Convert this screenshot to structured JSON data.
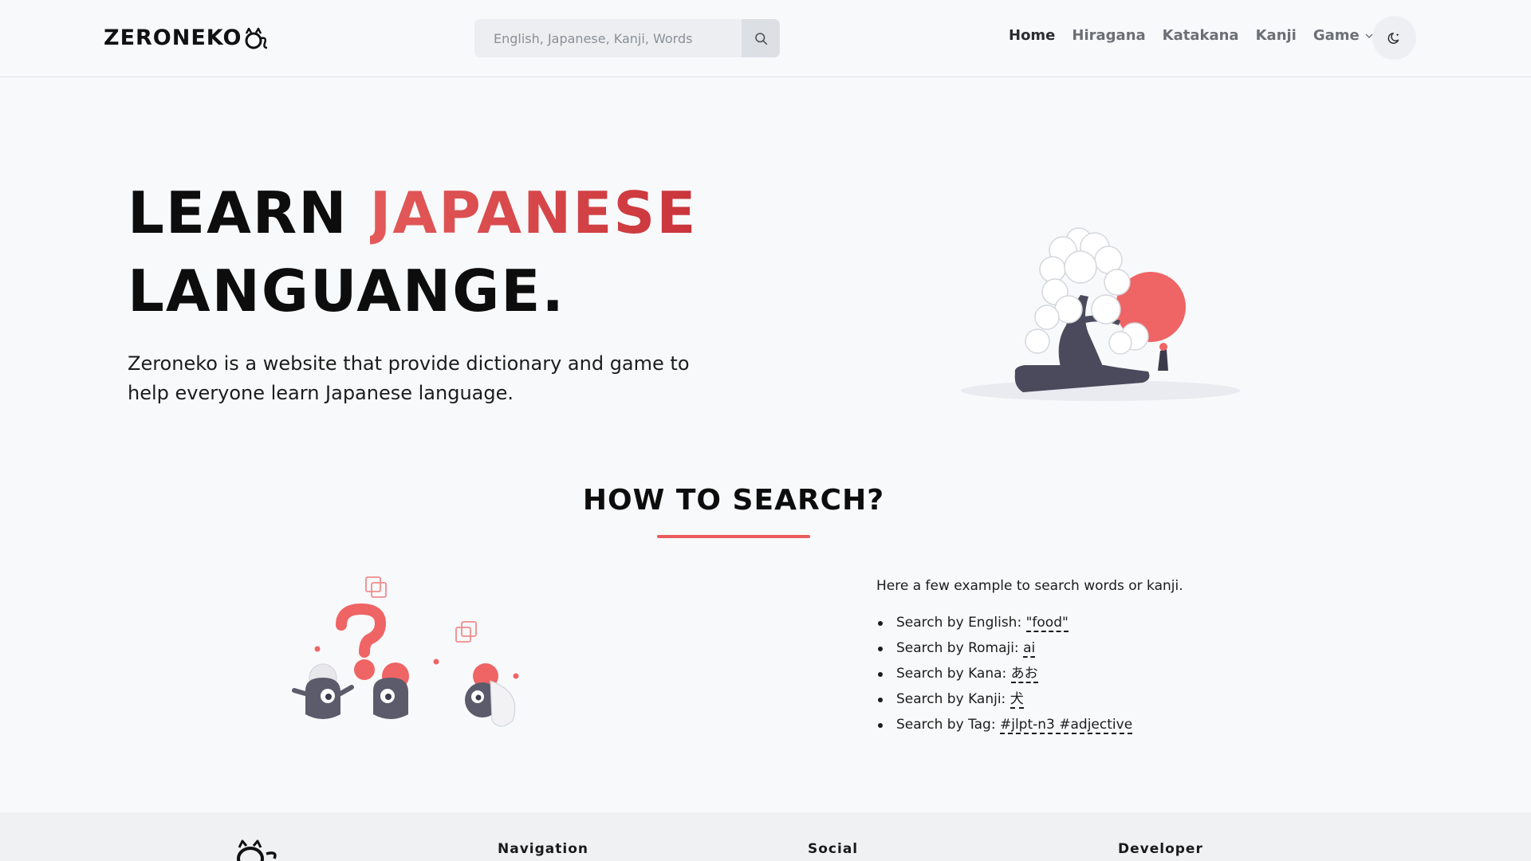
{
  "header": {
    "logo_text": "ZERONEKO",
    "search": {
      "placeholder": "English, Japanese, Kanji, Words"
    },
    "nav": [
      {
        "label": "Home",
        "active": true
      },
      {
        "label": "Hiragana"
      },
      {
        "label": "Katakana"
      },
      {
        "label": "Kanji"
      },
      {
        "label": "Game",
        "has_dropdown": true
      }
    ],
    "theme_icon": "moon-sparkle-icon"
  },
  "hero": {
    "title_part1": "LEARN",
    "title_accent": "JAPANESE",
    "title_line2": "LANGUANGE.",
    "description": "Zeroneko is a website that provide dictionary and game to help everyone learn Japanese language.",
    "accent_color": "#d9434a"
  },
  "how_to_search": {
    "title": "HOW TO SEARCH?",
    "intro": "Here a few example to search words or kanji.",
    "examples": [
      {
        "label": "Search by English:",
        "query": "\"food\""
      },
      {
        "label": "Search by Romaji:",
        "query": "ai"
      },
      {
        "label": "Search by Kana:",
        "query": "あお"
      },
      {
        "label": "Search by Kanji:",
        "query": "犬"
      },
      {
        "label": "Search by Tag:",
        "query": "#jlpt-n3 #adjective"
      }
    ]
  },
  "footer": {
    "columns": [
      "Navigation",
      "Social",
      "Developer"
    ]
  },
  "colors": {
    "accent": "#ea5b5b",
    "background": "#f8f9fb"
  }
}
